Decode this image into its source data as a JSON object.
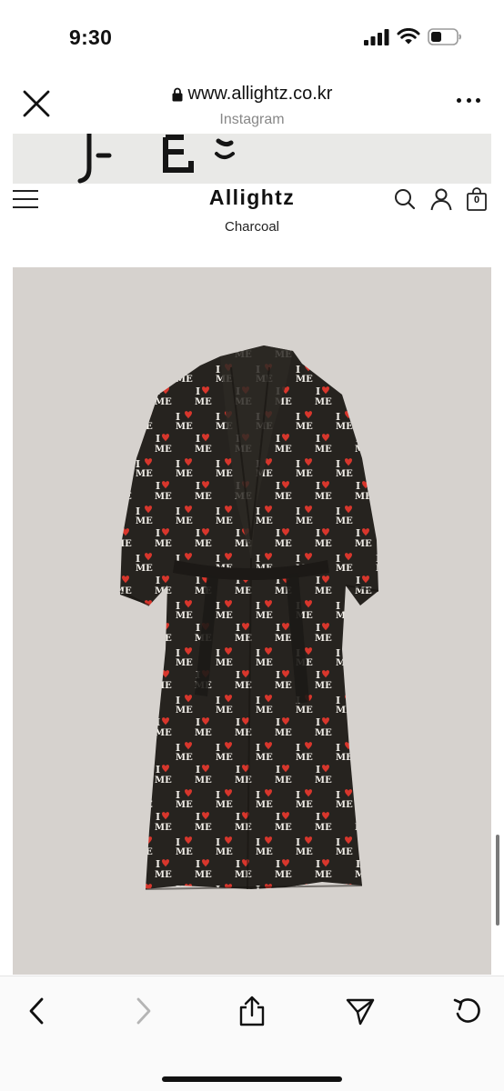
{
  "status_bar": {
    "time": "9:30"
  },
  "browser": {
    "url": "www.allightz.co.kr",
    "source": "Instagram",
    "icons": [
      "close-icon",
      "lock-icon",
      "more-icon"
    ]
  },
  "site": {
    "brand": "Allightz",
    "subtitle": "Charcoal",
    "cart_count": "0",
    "icons": [
      "menu-icon",
      "search-icon",
      "user-icon",
      "cart-icon"
    ]
  },
  "product": {
    "image_background": "#d6d2ce",
    "robe_color": "#26231f",
    "heart_color": "#d8362c",
    "print_text_top": "I",
    "print_text_bottom": "ME"
  },
  "toolbar": {
    "icons": [
      "back-icon",
      "forward-icon",
      "share-icon",
      "send-icon",
      "reload-icon"
    ]
  }
}
